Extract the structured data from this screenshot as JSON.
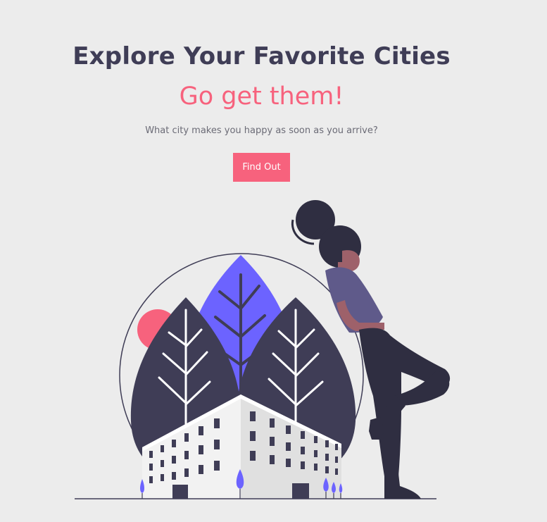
{
  "hero": {
    "title": "Explore Your Favorite Cities",
    "subtitle": "Go get them!",
    "tagline": "What city makes you happy as soon as you arrive?",
    "cta_label": "Find Out"
  },
  "illustration": {
    "icon": "woman-leaning-on-city-globe-illustration",
    "colors": {
      "dark": "#3f3d56",
      "accent_purple": "#6c63ff",
      "accent_pink": "#f7627d",
      "building": "#f2f2f2",
      "skin": "#9e616a",
      "shirt": "#5f5a8a",
      "hair": "#2f2e41"
    }
  }
}
